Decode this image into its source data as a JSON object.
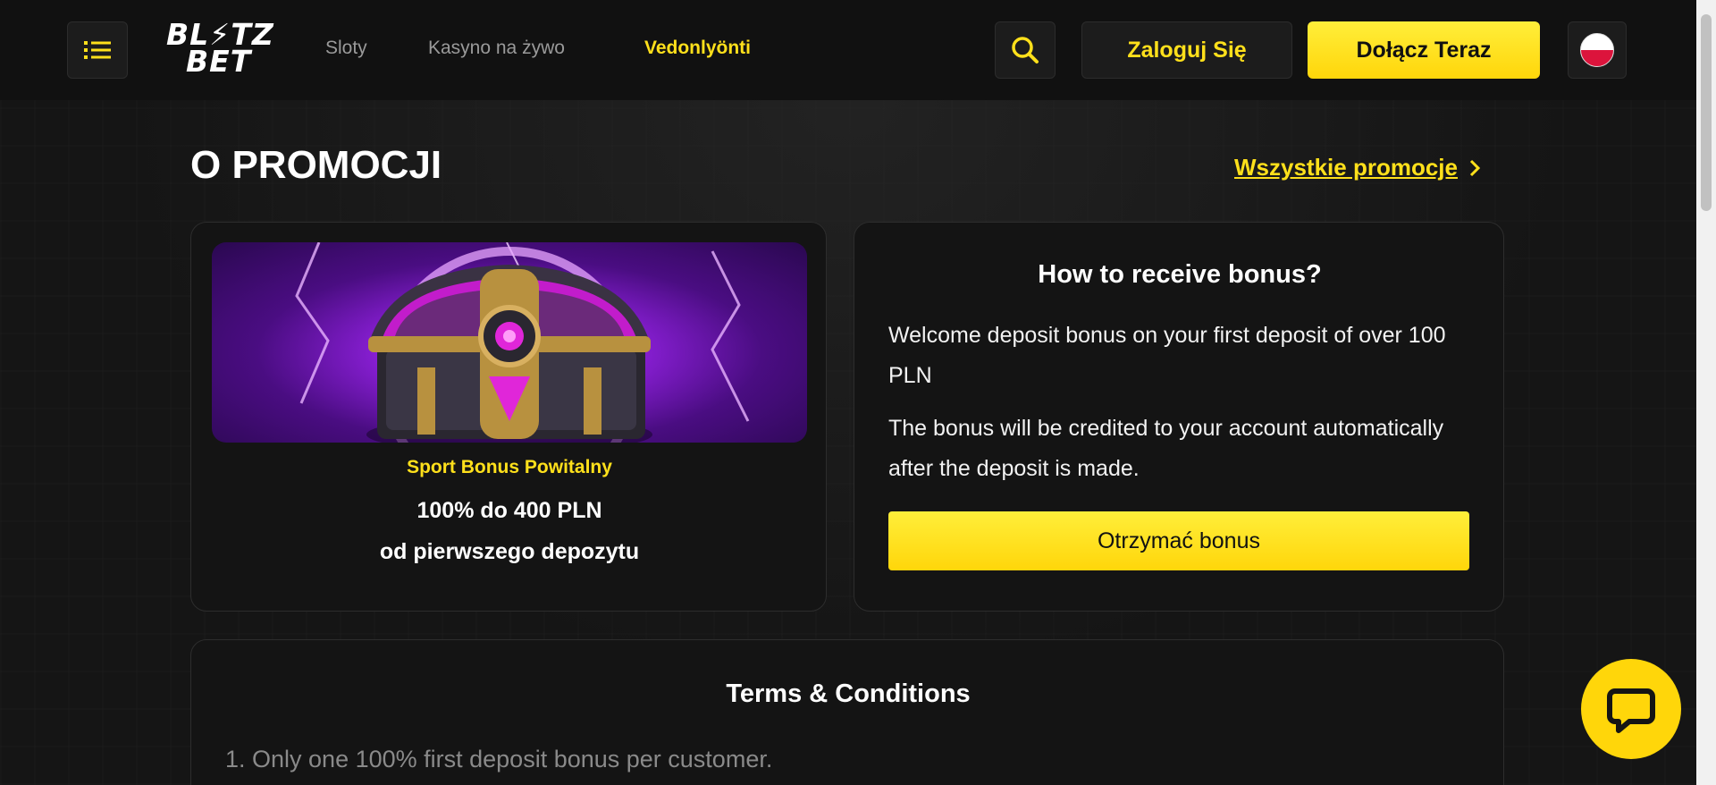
{
  "header": {
    "logo_line1": "BL⚡TZ",
    "logo_line2": "BET",
    "nav": [
      "Sloty",
      "Kasyno na żywo",
      "Vedonlyönti"
    ],
    "login_label": "Zaloguj Się",
    "join_label": "Dołącz Teraz"
  },
  "main": {
    "title": "O PROMOCJI",
    "all_promotions": "Wszystkie promocje",
    "promo": {
      "subtitle": "Sport Bonus Powitalny",
      "amount": "100% do 400 PLN",
      "from": "od pierwszego depozytu"
    },
    "how": {
      "title": "How to receive bonus?",
      "p1": "Welcome deposit bonus on your first deposit of over 100 PLN",
      "p2": "The bonus will be credited to your account automatically after the deposit is made.",
      "button": "Otrzymać bonus"
    },
    "terms": {
      "title": "Terms & Conditions",
      "item1": "1. Only one 100% first deposit bonus per customer."
    }
  },
  "colors": {
    "accent": "#ffe01b",
    "background": "#141414"
  }
}
